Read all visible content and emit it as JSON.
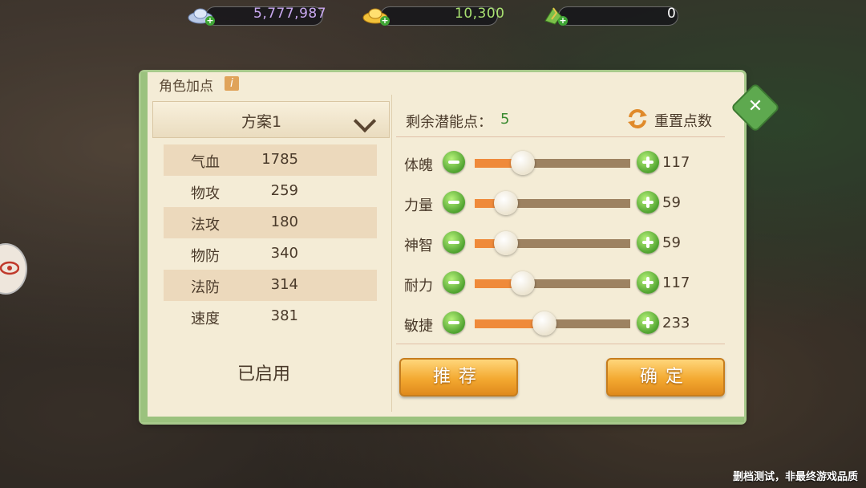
{
  "currencies": [
    {
      "name": "silver-ingot-icon",
      "value": "5,777,987",
      "color": "#c9a8f0"
    },
    {
      "name": "gold-ingot-icon",
      "value": "10,300",
      "color": "#a8e070"
    },
    {
      "name": "jade-icon",
      "value": "0",
      "color": "#ffffff"
    }
  ],
  "panel": {
    "title": "角色加点",
    "info_icon": "i",
    "plan": {
      "selected": "方案1"
    },
    "stats": [
      {
        "name": "气血",
        "value": "1785"
      },
      {
        "name": "物攻",
        "value": "259"
      },
      {
        "name": "法攻",
        "value": "180"
      },
      {
        "name": "物防",
        "value": "340"
      },
      {
        "name": "法防",
        "value": "314"
      },
      {
        "name": "速度",
        "value": "381"
      }
    ],
    "enabled_text": "已启用",
    "remaining_label": "剩余潜能点：",
    "remaining_value": "5",
    "reset_label": "重置点数",
    "attributes": [
      {
        "name": "体魄",
        "value": "117",
        "level": 0.31
      },
      {
        "name": "力量",
        "value": "59",
        "level": 0.2
      },
      {
        "name": "神智",
        "value": "59",
        "level": 0.2
      },
      {
        "name": "耐力",
        "value": "117",
        "level": 0.31
      },
      {
        "name": "敏捷",
        "value": "233",
        "level": 0.45
      }
    ],
    "recommend_label": "推荐",
    "confirm_label": "确定"
  },
  "watermark": "删档测试，非最终游戏品质"
}
